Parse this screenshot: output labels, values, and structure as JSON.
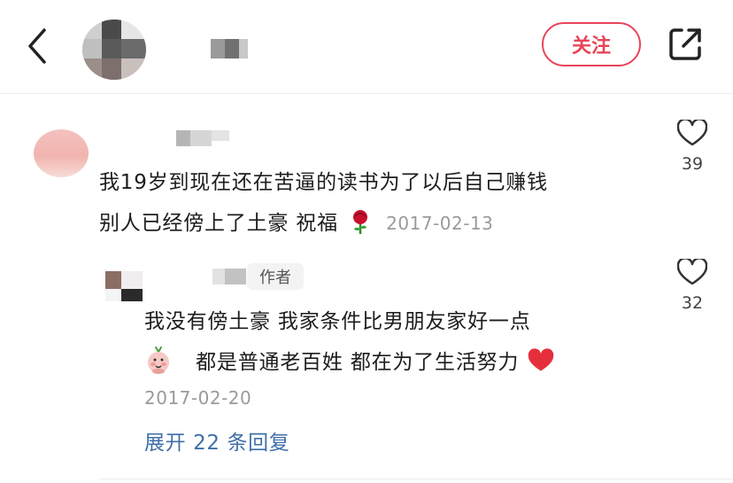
{
  "header": {
    "follow_label": "关注",
    "icons": {
      "back": "back-chevron-icon",
      "share": "share-external-icon"
    }
  },
  "comment": {
    "line1": "我19岁到现在还在苦逼的读书为了以后自己赚钱",
    "line2": "别人已经傍上了土豪 祝福",
    "emoji": "rose-emoji",
    "date": "2017-02-13",
    "likes": "39"
  },
  "reply": {
    "author_badge": "作者",
    "line1": "我没有傍土豪   我家条件比男朋友家好一点",
    "line2": "都是普通老百姓  都在为了生活努力",
    "emoji_before": "flower-face-emoji",
    "emoji_after": "red-heart-emoji",
    "date": "2017-02-20",
    "likes": "32"
  },
  "expand_label": "展开 22 条回复",
  "colors": {
    "accent": "#e8455a",
    "link": "#3f6fa8",
    "muted": "#9a9a9a"
  }
}
